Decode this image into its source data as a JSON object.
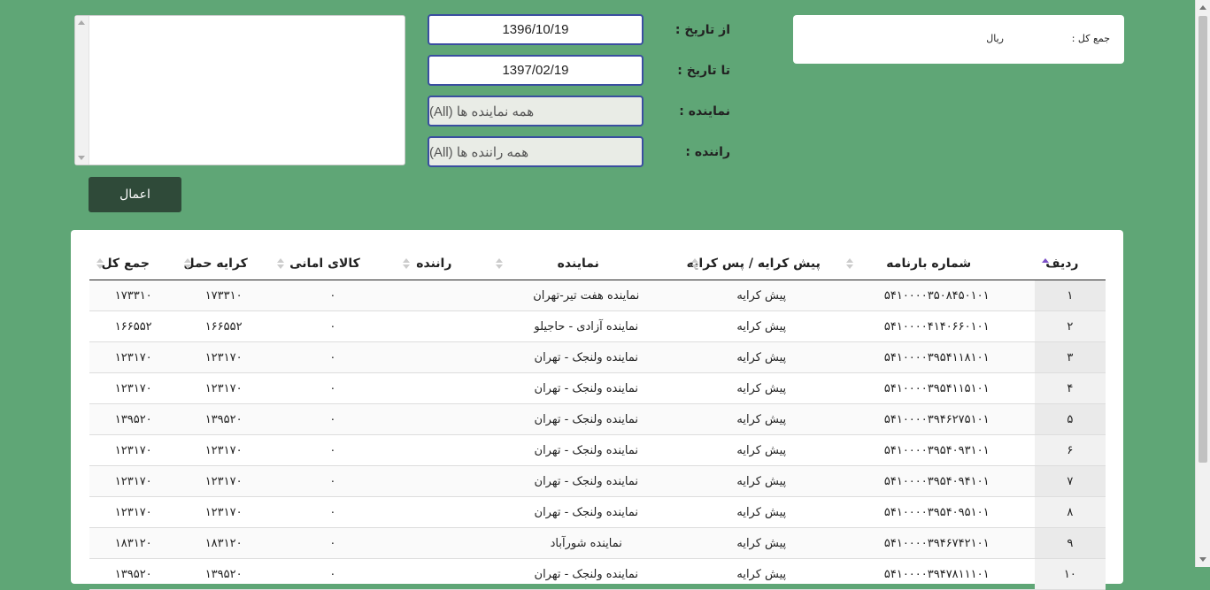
{
  "summary": {
    "total_label": "جمع کل :",
    "unit": "ریال"
  },
  "filters": {
    "from_label": "از تاریخ :",
    "from_value": "1396/10/19",
    "to_label": "تا تاریخ :",
    "to_value": "1397/02/19",
    "agent_label": "نماینده :",
    "agent_value": "همه نماینده ها (All)",
    "driver_label": "راننده :",
    "driver_value": "همه راننده ها (All)"
  },
  "apply_label": "اعمال",
  "table": {
    "columns": [
      "ردیف",
      "شماره بارنامه",
      "پیش کرایه / پس کرایه",
      "نماینده",
      "راننده",
      "کالای امانی",
      "کرایه حمل",
      "جمع کل"
    ],
    "rows": [
      [
        "۱",
        "۵۴۱۰۰۰۰۳۵۰۸۴۵۰۱۰۱",
        "پیش کرایه",
        "نماینده هفت تیر-تهران",
        "",
        "۰",
        "۱۷۳۳۱۰",
        "۱۷۳۳۱۰"
      ],
      [
        "۲",
        "۵۴۱۰۰۰۰۴۱۴۰۶۶۰۱۰۱",
        "پیش کرایه",
        "نماینده آزادی - حاجیلو",
        "",
        "۰",
        "۱۶۶۵۵۲",
        "۱۶۶۵۵۲"
      ],
      [
        "۳",
        "۵۴۱۰۰۰۰۳۹۵۴۱۱۸۱۰۱",
        "پیش کرایه",
        "نماینده ولنجک - تهران",
        "",
        "۰",
        "۱۲۳۱۷۰",
        "۱۲۳۱۷۰"
      ],
      [
        "۴",
        "۵۴۱۰۰۰۰۳۹۵۴۱۱۵۱۰۱",
        "پیش کرایه",
        "نماینده ولنجک - تهران",
        "",
        "۰",
        "۱۲۳۱۷۰",
        "۱۲۳۱۷۰"
      ],
      [
        "۵",
        "۵۴۱۰۰۰۰۳۹۴۶۲۷۵۱۰۱",
        "پیش کرایه",
        "نماینده ولنجک - تهران",
        "",
        "۰",
        "۱۳۹۵۲۰",
        "۱۳۹۵۲۰"
      ],
      [
        "۶",
        "۵۴۱۰۰۰۰۳۹۵۴۰۹۳۱۰۱",
        "پیش کرایه",
        "نماینده ولنجک - تهران",
        "",
        "۰",
        "۱۲۳۱۷۰",
        "۱۲۳۱۷۰"
      ],
      [
        "۷",
        "۵۴۱۰۰۰۰۳۹۵۴۰۹۴۱۰۱",
        "پیش کرایه",
        "نماینده ولنجک - تهران",
        "",
        "۰",
        "۱۲۳۱۷۰",
        "۱۲۳۱۷۰"
      ],
      [
        "۸",
        "۵۴۱۰۰۰۰۳۹۵۴۰۹۵۱۰۱",
        "پیش کرایه",
        "نماینده ولنجک - تهران",
        "",
        "۰",
        "۱۲۳۱۷۰",
        "۱۲۳۱۷۰"
      ],
      [
        "۹",
        "۵۴۱۰۰۰۰۳۹۴۶۷۴۲۱۰۱",
        "پیش کرایه",
        "نماینده شورآباد",
        "",
        "۰",
        "۱۸۳۱۲۰",
        "۱۸۳۱۲۰"
      ],
      [
        "۱۰",
        "۵۴۱۰۰۰۰۳۹۴۷۸۱۱۱۰۱",
        "پیش کرایه",
        "نماینده ولنجک - تهران",
        "",
        "۰",
        "۱۳۹۵۲۰",
        "۱۳۹۵۲۰"
      ]
    ]
  }
}
